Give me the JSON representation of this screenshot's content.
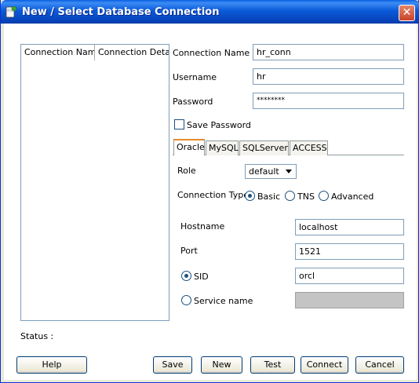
{
  "window": {
    "title": "New / Select Database Connection",
    "close_glyph": "✕"
  },
  "connections_table": {
    "columns": [
      "Connection Name",
      "Connection Details"
    ]
  },
  "form": {
    "connection_name_label": "Connection Name",
    "connection_name_value": "hr_conn",
    "username_label": "Username",
    "username_value": "hr",
    "password_label": "Password",
    "password_value": "********",
    "save_password_label": "Save Password",
    "save_password_checked": false
  },
  "tabs": [
    "Oracle",
    "MySQL",
    "SQLServer",
    "ACCESS"
  ],
  "active_tab": "Oracle",
  "oracle": {
    "role_label": "Role",
    "role_value": "default",
    "connection_type_label": "Connection Type",
    "connection_types": [
      "Basic",
      "TNS",
      "Advanced"
    ],
    "connection_type_selected": "Basic",
    "hostname_label": "Hostname",
    "hostname_value": "localhost",
    "port_label": "Port",
    "port_value": "1521",
    "sid_label": "SID",
    "sid_value": "orcl",
    "sid_selected": true,
    "service_name_label": "Service name",
    "service_name_value": ""
  },
  "status_label": "Status :",
  "buttons": {
    "help": "Help",
    "save": "Save",
    "new": "New",
    "test": "Test",
    "connect": "Connect",
    "cancel": "Cancel"
  }
}
